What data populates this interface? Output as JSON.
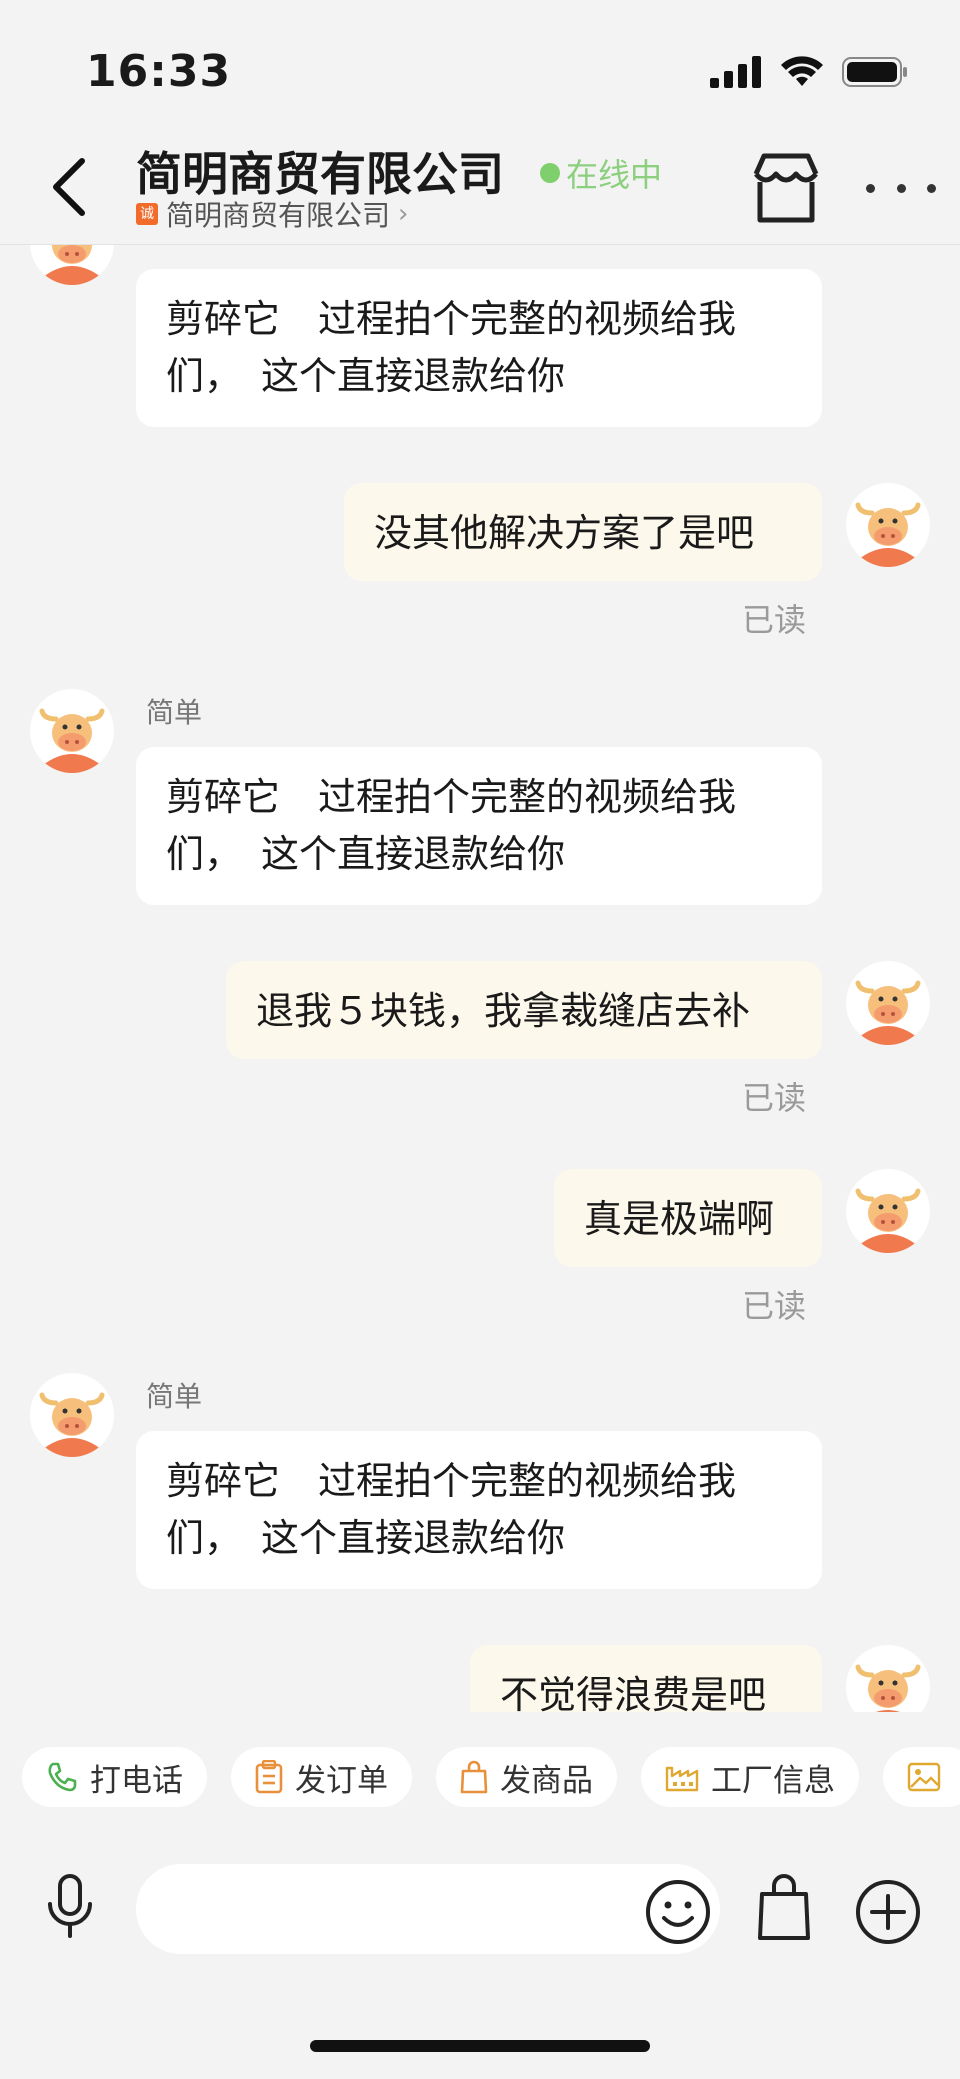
{
  "status_bar": {
    "time": "16:33"
  },
  "header": {
    "title": "简明商贸有限公司",
    "online_status": "在线中",
    "subtitle": "简明商贸有限公司",
    "badge": "诚",
    "subtitle_chevron": "›"
  },
  "messages": [
    {
      "side": "in",
      "sender": "",
      "text": "剪碎它　过程拍个完整的视频给我们，　这个直接退款给你"
    },
    {
      "side": "out",
      "text": "没其他解决方案了是吧",
      "read": "已读"
    },
    {
      "side": "in",
      "sender": "简单",
      "text": "剪碎它　过程拍个完整的视频给我们，　这个直接退款给你"
    },
    {
      "side": "out",
      "text": "退我５块钱，我拿裁缝店去补",
      "read": "已读"
    },
    {
      "side": "out",
      "text": "真是极端啊",
      "read": "已读"
    },
    {
      "side": "in",
      "sender": "简单",
      "text": "剪碎它　过程拍个完整的视频给我们，　这个直接退款给你"
    },
    {
      "side": "out",
      "text": "不觉得浪费是吧"
    }
  ],
  "quick_actions": [
    {
      "label": "打电话",
      "icon": "phone-icon"
    },
    {
      "label": "发订单",
      "icon": "clipboard-icon"
    },
    {
      "label": "发商品",
      "icon": "shopping-bag-icon"
    },
    {
      "label": "工厂信息",
      "icon": "factory-icon"
    },
    {
      "label": "",
      "icon": "image-icon"
    }
  ],
  "input": {
    "placeholder": ""
  },
  "colors": {
    "background": "#f3f3f3",
    "incoming_bubble": "#ffffff",
    "outgoing_bubble": "#fdf8ec",
    "online_green": "#7fcf6d",
    "brand_orange": "#f26b2b",
    "read_text": "#9a9a9a"
  }
}
